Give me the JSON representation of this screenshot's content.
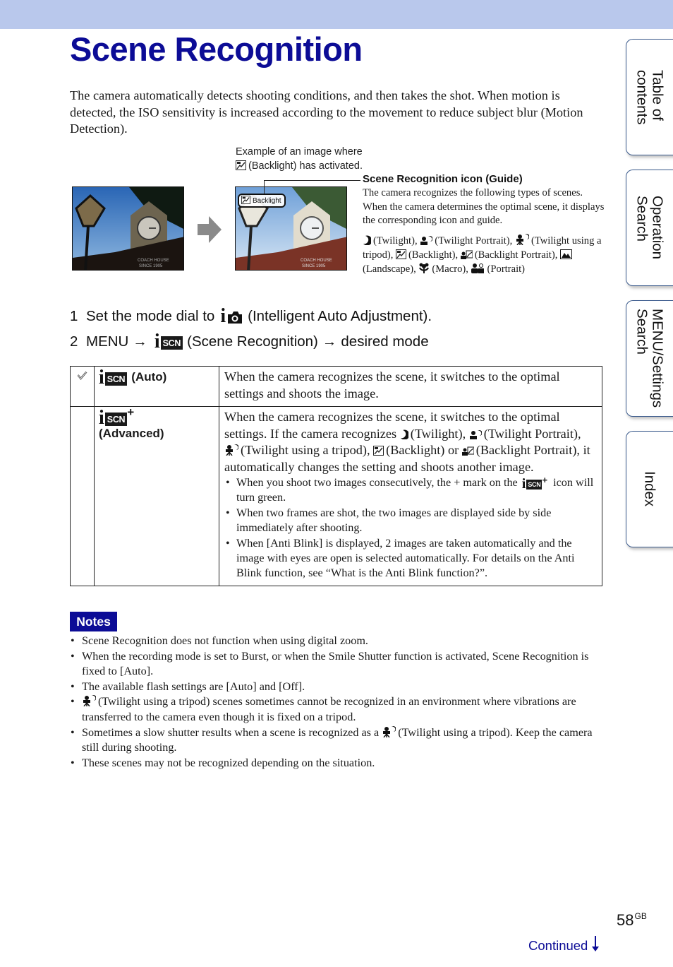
{
  "header": {
    "band_color": "#b9c8ec"
  },
  "page_title": "Scene Recognition",
  "intro": "The camera automatically detects shooting conditions, and then takes the shot. When motion is detected, the ISO sensitivity is increased according to the movement to reduce subject blur (Motion Detection).",
  "figure": {
    "caption_line1": "Example of an image where",
    "caption_line2": "(Backlight) has activated.",
    "badge_label": "Backlight",
    "before_image": "clock-tower-photo-before",
    "after_image": "clock-tower-photo-after",
    "sign_text_1": "COACH HOUSE",
    "sign_text_2": "SINCE 1905"
  },
  "guide": {
    "title": "Scene Recognition icon (Guide)",
    "body": "The camera recognizes the following types of scenes. When the camera determines the optimal scene, it displays the corresponding icon and guide.",
    "scenes": [
      {
        "icon": "twilight-icon",
        "label": "(Twilight),",
        "sep": " "
      },
      {
        "icon": "twilight-portrait-icon",
        "label": "(Twilight Portrait),",
        "sep": " "
      },
      {
        "icon": "twilight-tripod-icon",
        "label": "(Twilight using a tripod),",
        "sep": " "
      },
      {
        "icon": "backlight-icon",
        "label": "(Backlight),",
        "sep": " "
      },
      {
        "icon": "backlight-portrait-icon",
        "label": "(Backlight Portrait),",
        "sep": " "
      },
      {
        "icon": "landscape-icon",
        "label": "(Landscape),",
        "sep": " "
      },
      {
        "icon": "macro-icon",
        "label": "(Macro),",
        "sep": " "
      },
      {
        "icon": "portrait-icon",
        "label": "(Portrait)",
        "sep": ""
      }
    ]
  },
  "steps": {
    "step1_num": "1",
    "step1_pre": "Set the mode dial to",
    "step1_post": "(Intelligent Auto Adjustment).",
    "step2_num": "2",
    "step2_menu": "MENU",
    "step2_mid": "(Scene Recognition)",
    "step2_post": "desired mode",
    "arrow": "→"
  },
  "icon_text": {
    "i": "i",
    "scn": "SCN",
    "plus": "+"
  },
  "table": {
    "rows": [
      {
        "default": true,
        "mode_label": "(Auto)",
        "desc": "When the camera recognizes the scene, it switches to the optimal settings and shoots the image."
      },
      {
        "default": false,
        "mode_label": "(Advanced)",
        "desc_1": "When the camera recognizes the scene, it switches to the optimal settings. If the camera recognizes",
        "desc_twilight": "(Twilight),",
        "desc_twilight_portrait": "(Twilight Portrait),",
        "desc_tripod": "(Twilight using a tripod),",
        "desc_backlight": "(Backlight) or",
        "desc_backlight_portrait": "(Backlight Portrait), it automatically changes the setting and shoots another image.",
        "bullet1_pre": "When you shoot two images consecutively, the + mark on the",
        "bullet1_post": "icon will turn green.",
        "bullet2": "When two frames are shot, the two images are displayed side by side immediately after shooting.",
        "bullet3": "When [Anti Blink] is displayed, 2 images are taken automatically and the image with eyes are open is selected automatically. For details on the Anti Blink function, see “What is the Anti Blink function?”."
      }
    ]
  },
  "notes": {
    "label": "Notes",
    "items": [
      "Scene Recognition does not function when using digital zoom.",
      "When the recording mode is set to Burst, or when the Smile Shutter function is activated, Scene Recognition is fixed to [Auto].",
      "The available flash settings are [Auto] and [Off].",
      "(Twilight using a tripod) scenes sometimes cannot be recognized in an environment where vibrations are transferred to the camera even though it is fixed on a tripod.",
      "Sometimes a slow shutter results when a scene is recognized as a",
      "These scenes may not be recognized depending on the situation."
    ],
    "item5_post": "(Twilight using a tripod). Keep the camera still during shooting."
  },
  "side_tabs": [
    {
      "label": "Table of\ncontents"
    },
    {
      "label": "Operation\nSearch"
    },
    {
      "label": "MENU/Settings\nSearch"
    },
    {
      "label": "Index"
    }
  ],
  "footer": {
    "page_number": "58",
    "page_suffix": "GB",
    "continued": "Continued",
    "continued_arrow": "↓"
  },
  "colors": {
    "title": "#0c0c96",
    "notes_bg": "#0c0c96",
    "tab_border": "#3a5a8c",
    "link": "#0c0c96"
  }
}
